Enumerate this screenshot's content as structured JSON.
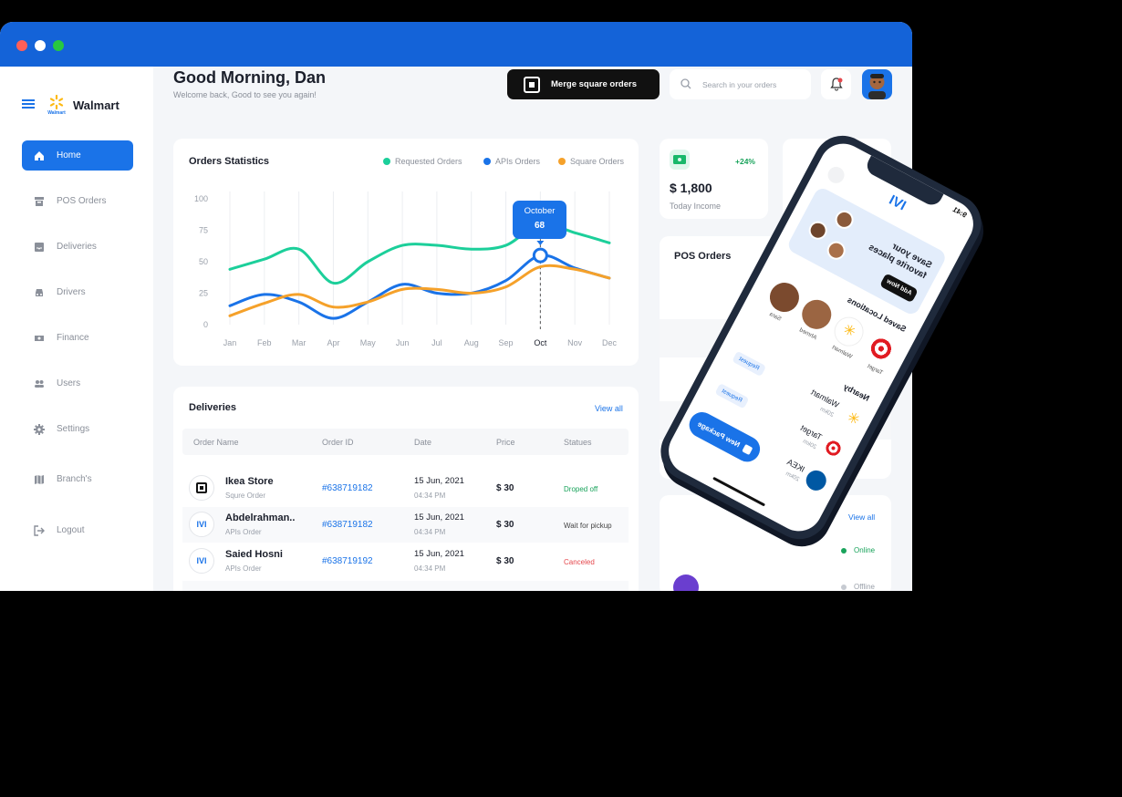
{
  "brand": {
    "name": "Walmart",
    "logo_sub": "Walmart"
  },
  "header": {
    "greeting": "Good Morning, Dan",
    "subtitle": "Welcome back, Good to see you again!",
    "merge_button": "Merge square orders",
    "search_placeholder": "Search in your orders"
  },
  "sidebar": {
    "items": [
      {
        "label": "Home",
        "icon": "home-icon"
      },
      {
        "label": "POS Orders",
        "icon": "archive-icon"
      },
      {
        "label": "Deliveries",
        "icon": "inbox-icon"
      },
      {
        "label": "Drivers",
        "icon": "car-icon"
      },
      {
        "label": "Finance",
        "icon": "money-icon"
      },
      {
        "label": "Users",
        "icon": "users-icon"
      },
      {
        "label": "Settings",
        "icon": "gear-icon"
      },
      {
        "label": "Branch's",
        "icon": "map-icon"
      },
      {
        "label": "Logout",
        "icon": "logout-icon"
      }
    ]
  },
  "orders_stats": {
    "title": "Orders Statistics",
    "legend": [
      "Requested Orders",
      "APIs Orders",
      "Square Orders"
    ],
    "tooltip_month": "October",
    "tooltip_value": "68"
  },
  "chart_data": {
    "type": "line",
    "title": "Orders Statistics",
    "categories": [
      "Jan",
      "Feb",
      "Mar",
      "Apr",
      "May",
      "Jun",
      "Jul",
      "Aug",
      "Sep",
      "Oct",
      "Nov",
      "Dec"
    ],
    "ylim": [
      0,
      100
    ],
    "yticks": [
      "100",
      "75",
      "50",
      "25",
      "0"
    ],
    "colors": [
      "#1ccf9a",
      "#1a73e8",
      "#f5a12a"
    ],
    "series": [
      {
        "name": "Requested Orders",
        "values": [
          44,
          52,
          60,
          33,
          50,
          63,
          63,
          60,
          63,
          80,
          73,
          65
        ]
      },
      {
        "name": "APIs Orders",
        "values": [
          15,
          24,
          18,
          5,
          18,
          32,
          25,
          25,
          35,
          55,
          45,
          37
        ]
      },
      {
        "name": "Square Orders",
        "values": [
          7,
          17,
          24,
          14,
          18,
          28,
          28,
          25,
          30,
          46,
          44,
          37
        ]
      }
    ],
    "highlight": {
      "category": "Oct",
      "value": 68
    }
  },
  "income": {
    "amount": "$ 1,800",
    "label": "Today Income",
    "change": "+24%"
  },
  "pos_orders_title": "POS Orders",
  "deliveries": {
    "title": "Deliveries",
    "view_all": "View all",
    "columns": [
      "Order Name",
      "Order ID",
      "Date",
      "Price",
      "Statues"
    ],
    "rows": [
      {
        "name": "Ikea Store",
        "sub": "Squre Order",
        "id": "#638719182",
        "date": "15 Jun, 2021",
        "time": "04:34 PM",
        "price": "$ 30",
        "status": "Droped off",
        "status_color": "#19a35b"
      },
      {
        "name": "Abdelrahman..",
        "sub": "APIs Order",
        "id": "#638719182",
        "date": "15 Jun, 2021",
        "time": "04:34 PM",
        "price": "$ 30",
        "status": "Wait for pickup",
        "status_color": "#444"
      },
      {
        "name": "Saied Hosni",
        "sub": "APIs Order",
        "id": "#638719192",
        "date": "15 Jun, 2021",
        "time": "04:34 PM",
        "price": "$ 30",
        "status": "Canceled",
        "status_color": "#e5484d"
      }
    ]
  },
  "drivers_card": {
    "view_all": "View all",
    "online": "Online",
    "offline": "Offline"
  },
  "phone": {
    "time": "9:41",
    "banner": "Save your favorite places",
    "add_now": "Add Now",
    "saved_title": "Saved Locations",
    "saved": [
      "Target",
      "Walmart",
      "Ahmed",
      "Sara"
    ],
    "nearby_title": "Nearby",
    "nearby": [
      {
        "name": "Walmart",
        "dist": "20km"
      },
      {
        "name": "Target",
        "dist": "20km"
      },
      {
        "name": "IKEA",
        "dist": "20km"
      }
    ],
    "request": "Request",
    "new_package": "New Package"
  }
}
